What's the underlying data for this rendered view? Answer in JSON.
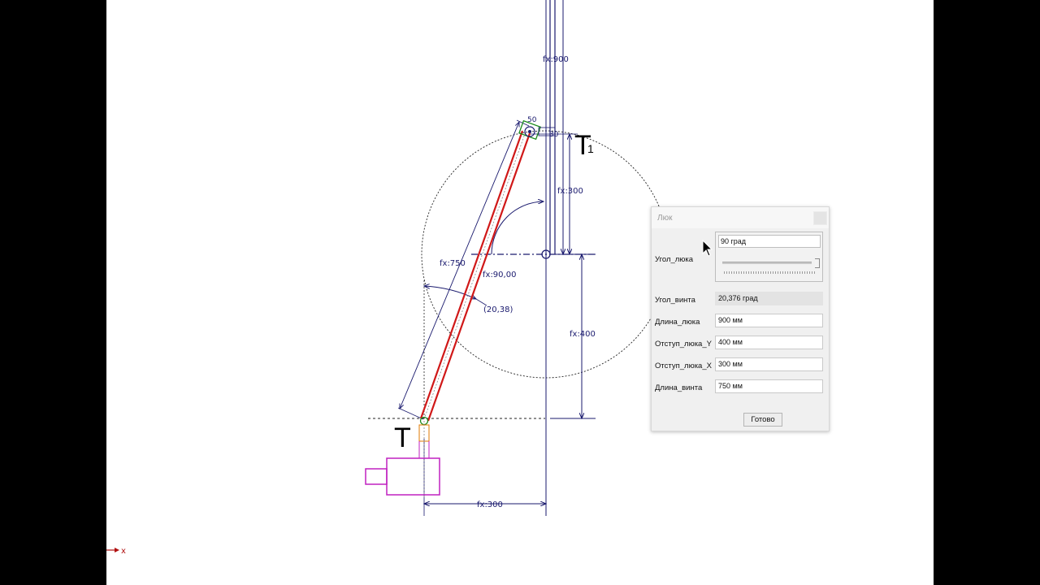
{
  "drawing": {
    "dimensions": {
      "top": "fx:900",
      "upper_right": "fx:300",
      "right": "fx:400",
      "bottom": "fx:300",
      "diagonal": "fx:750",
      "angle_main": "fx:90,00",
      "angle_screw": "(20,38)",
      "small_a": "50",
      "small_b": "30"
    },
    "labels": {
      "point_bottom": "T",
      "point_top": "T",
      "point_top_subscript": "1"
    },
    "axis_x_label": "x",
    "colors": {
      "dimension": "#1a1a6e",
      "screw": "#d01818",
      "motor": "#c020c0",
      "bracket": "#1a8a1a",
      "joint": "#e07a00"
    }
  },
  "dialog": {
    "title": "Люк",
    "rows": [
      {
        "label": "Угол_люка",
        "value": "90 град"
      },
      {
        "label": "Угол_винта",
        "value": "20,376 град"
      },
      {
        "label": "Длина_люка",
        "value": "900 мм"
      },
      {
        "label": "Отступ_люка_Y",
        "value": "400 мм"
      },
      {
        "label": "Отступ_люка_X",
        "value": "300 мм"
      },
      {
        "label": "Длина_винта",
        "value": "750 мм"
      }
    ],
    "ok_label": "Готово"
  }
}
